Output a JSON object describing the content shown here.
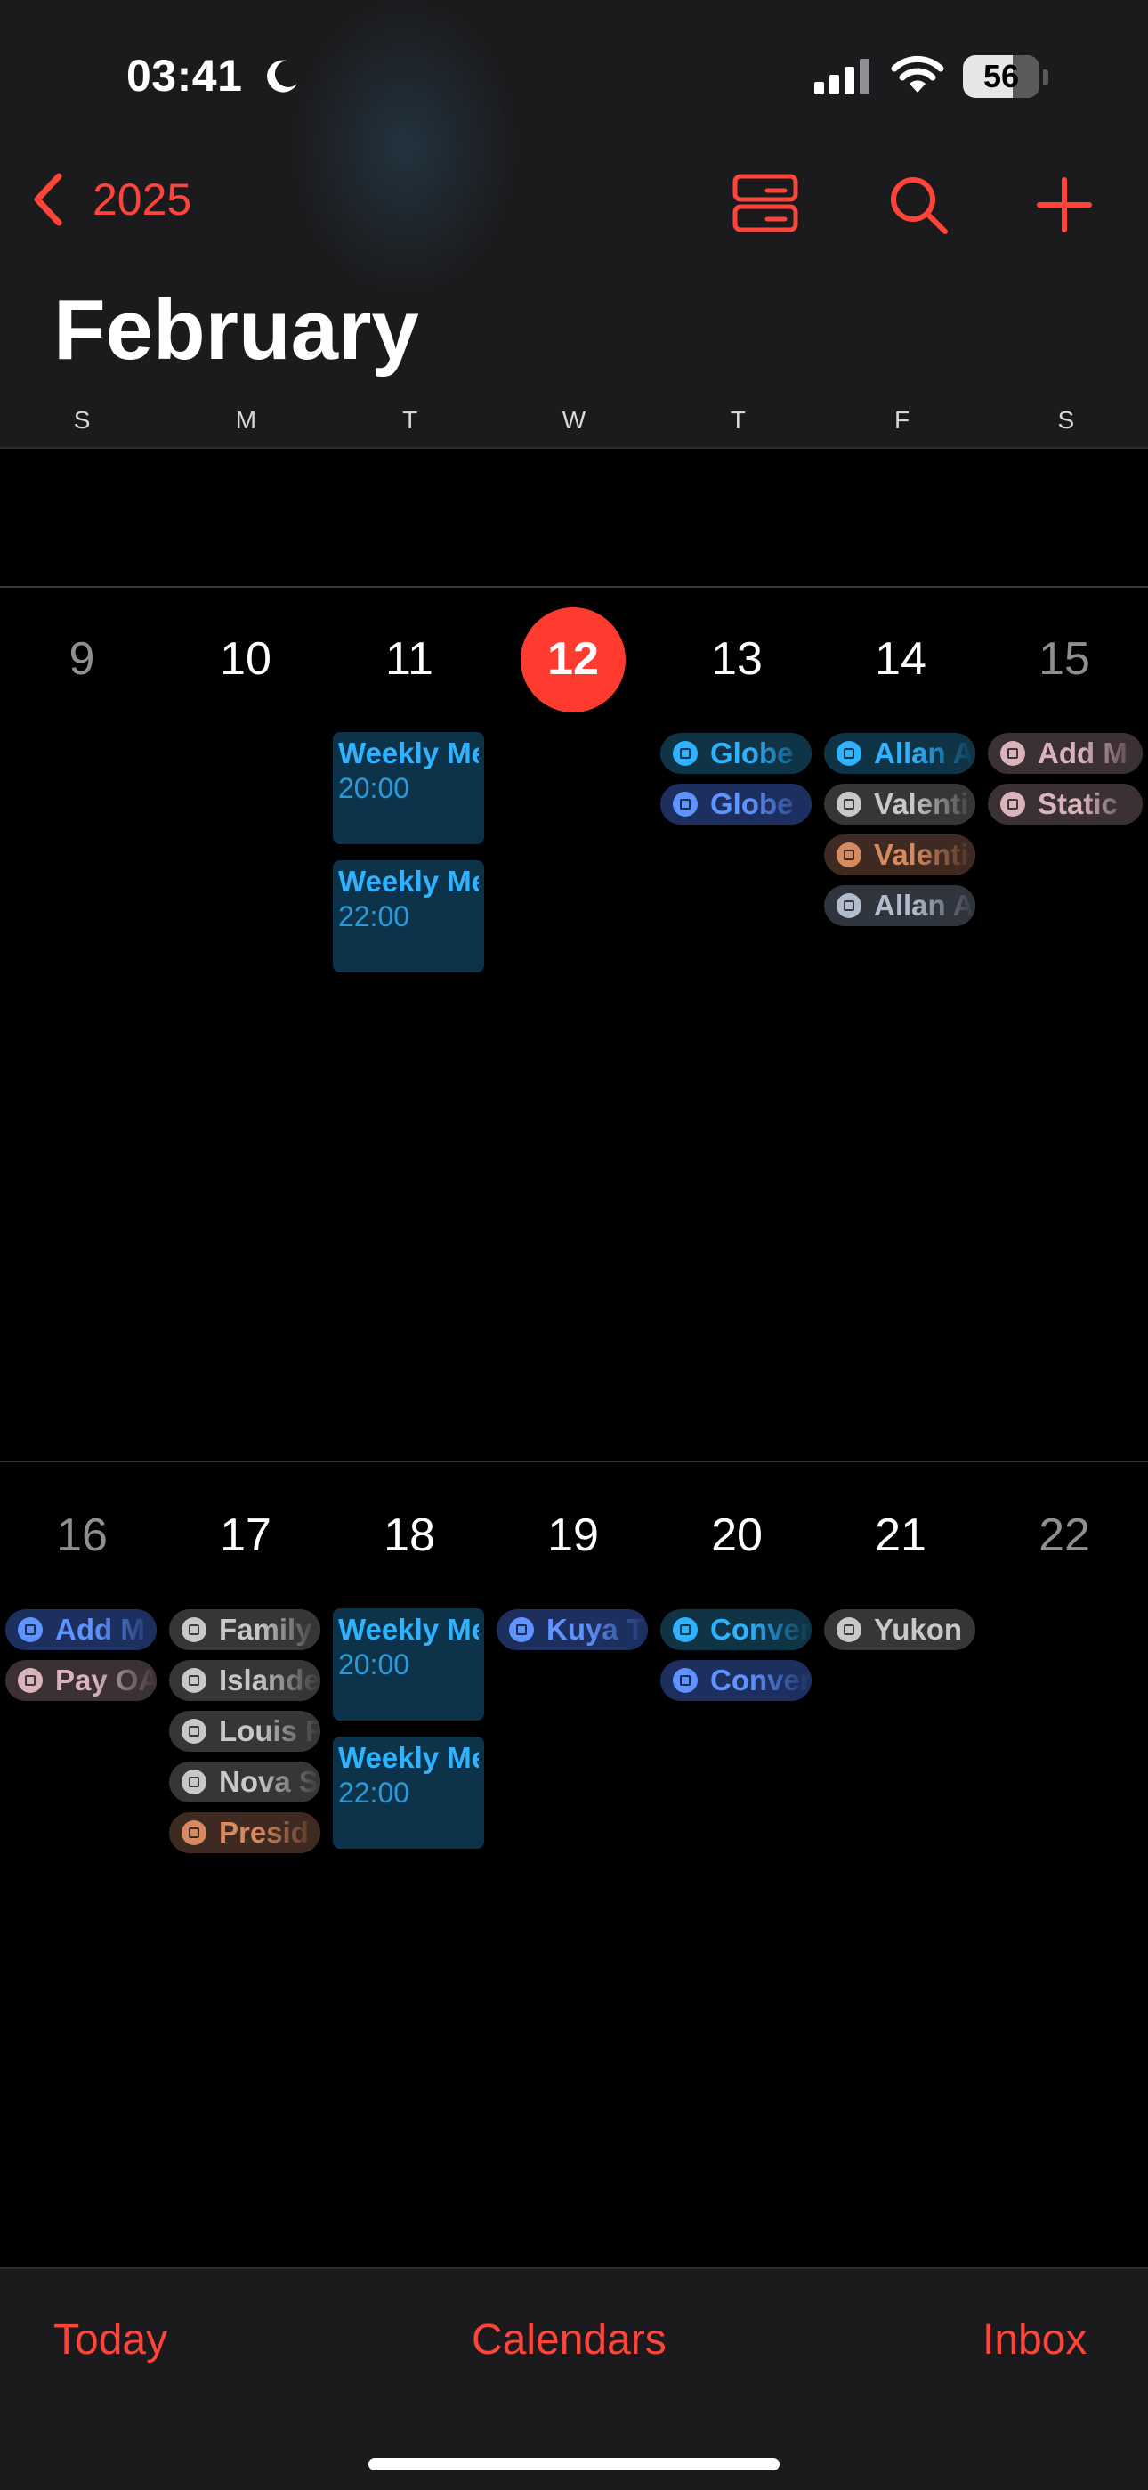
{
  "status_bar": {
    "time": "03:41",
    "battery": "56"
  },
  "nav": {
    "back_label": "2025",
    "month": "February"
  },
  "weekdays": [
    "S",
    "M",
    "T",
    "W",
    "T",
    "F",
    "S"
  ],
  "weeks": [
    {
      "days": [
        {
          "num": "9"
        },
        {
          "num": "10"
        },
        {
          "num": "11"
        },
        {
          "num": "12",
          "today": true
        },
        {
          "num": "13"
        },
        {
          "num": "14"
        },
        {
          "num": "15"
        }
      ],
      "events": {
        "tue_block1_title": "Weekly Meeting...",
        "tue_block1_time": "20:00",
        "tue_block2_title": "Weekly Meeting...",
        "tue_block2_time": "22:00",
        "thu_1": "Globe",
        "thu_2": "Globe",
        "fri_1": "Allan A",
        "fri_2": "Valenti",
        "fri_3": "Valenti",
        "fri_4": "Allan A",
        "sat_1": "Add M",
        "sat_2": "Static"
      }
    },
    {
      "days": [
        {
          "num": "16"
        },
        {
          "num": "17"
        },
        {
          "num": "18"
        },
        {
          "num": "19"
        },
        {
          "num": "20"
        },
        {
          "num": "21"
        },
        {
          "num": "22"
        }
      ],
      "events": {
        "sun_1": "Add M",
        "sun_2": "Pay OA",
        "mon_1": "Family",
        "mon_2": "Islande",
        "mon_3": "Louis F",
        "mon_4": "Nova S",
        "mon_5": "Presid",
        "tue_block1_title": "Weekly Meeting...",
        "tue_block1_time": "20:00",
        "tue_block2_title": "Weekly Meeting...",
        "tue_block2_time": "22:00",
        "wed_1": "Kuya T",
        "thu_1": "Conver",
        "thu_2": "Conver",
        "fri_1": "Yukon"
      }
    }
  ],
  "tabs": {
    "today": "Today",
    "calendars": "Calendars",
    "inbox": "Inbox"
  },
  "colors": {
    "accent": "#ff453a",
    "today_circle": "#ff3b30",
    "event_cyan": "#2fb2ff",
    "event_blue": "#5f93ff"
  },
  "icons": [
    "moon-icon",
    "cellular-signal-icon",
    "wifi-icon",
    "battery-icon",
    "chevron-left-icon",
    "list-view-icon",
    "search-icon",
    "plus-icon"
  ]
}
